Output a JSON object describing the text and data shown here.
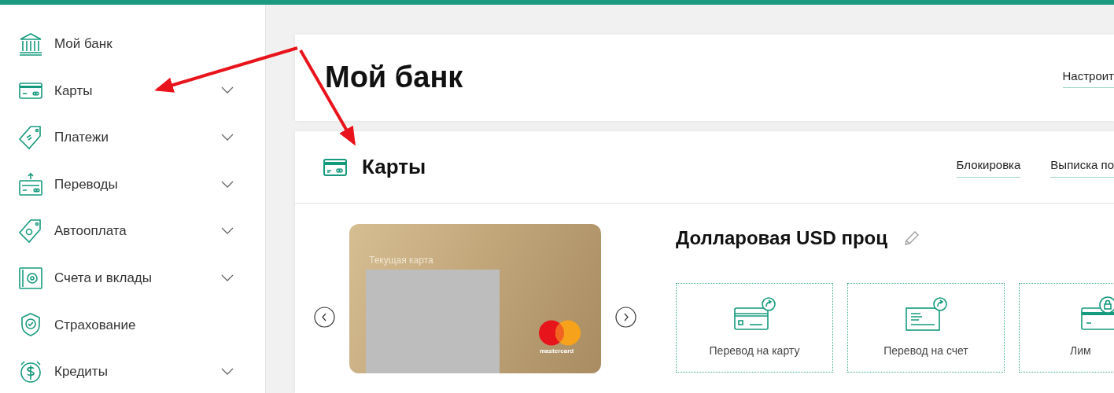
{
  "sidebar": {
    "items": [
      {
        "label": "Мой банк",
        "has_submenu": false
      },
      {
        "label": "Карты",
        "has_submenu": true
      },
      {
        "label": "Платежи",
        "has_submenu": true
      },
      {
        "label": "Переводы",
        "has_submenu": true
      },
      {
        "label": "Автооплата",
        "has_submenu": true
      },
      {
        "label": "Счета и вклады",
        "has_submenu": true
      },
      {
        "label": "Страхование",
        "has_submenu": false
      },
      {
        "label": "Кредиты",
        "has_submenu": true
      }
    ]
  },
  "header": {
    "title": "Мой банк",
    "action": "Настроит"
  },
  "cards_panel": {
    "title": "Карты",
    "actions": [
      "Блокировка",
      "Выписка по"
    ],
    "card": {
      "caption": "Текущая карта",
      "brand": "mastercard"
    },
    "account_title": "Долларовая USD проц",
    "tiles": [
      {
        "label": "Перевод на карту"
      },
      {
        "label": "Перевод на счет"
      },
      {
        "label": "Лим"
      }
    ]
  }
}
